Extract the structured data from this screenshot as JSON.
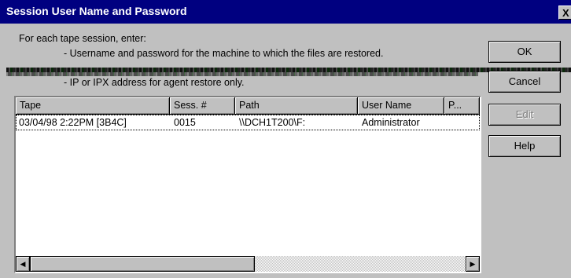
{
  "window": {
    "title": "Session User Name and Password",
    "close_label": "X"
  },
  "instructions": {
    "line1": "For each tape session, enter:",
    "line2": "- Username and password for the machine to which the files are restored.",
    "line4": "- IP or IPX address for agent restore only."
  },
  "buttons": {
    "ok": "OK",
    "cancel": "Cancel",
    "edit": "Edit",
    "help": "Help"
  },
  "table": {
    "columns": [
      "Tape",
      "Sess. #",
      "Path",
      "User Name",
      "P..."
    ],
    "rows": [
      [
        "03/04/98 2:22PM [3B4C]",
        "0015",
        "\\\\DCH1T200\\F:",
        "Administrator",
        ""
      ]
    ]
  },
  "scrollbar": {
    "left_arrow": "◀",
    "right_arrow": "▶"
  }
}
